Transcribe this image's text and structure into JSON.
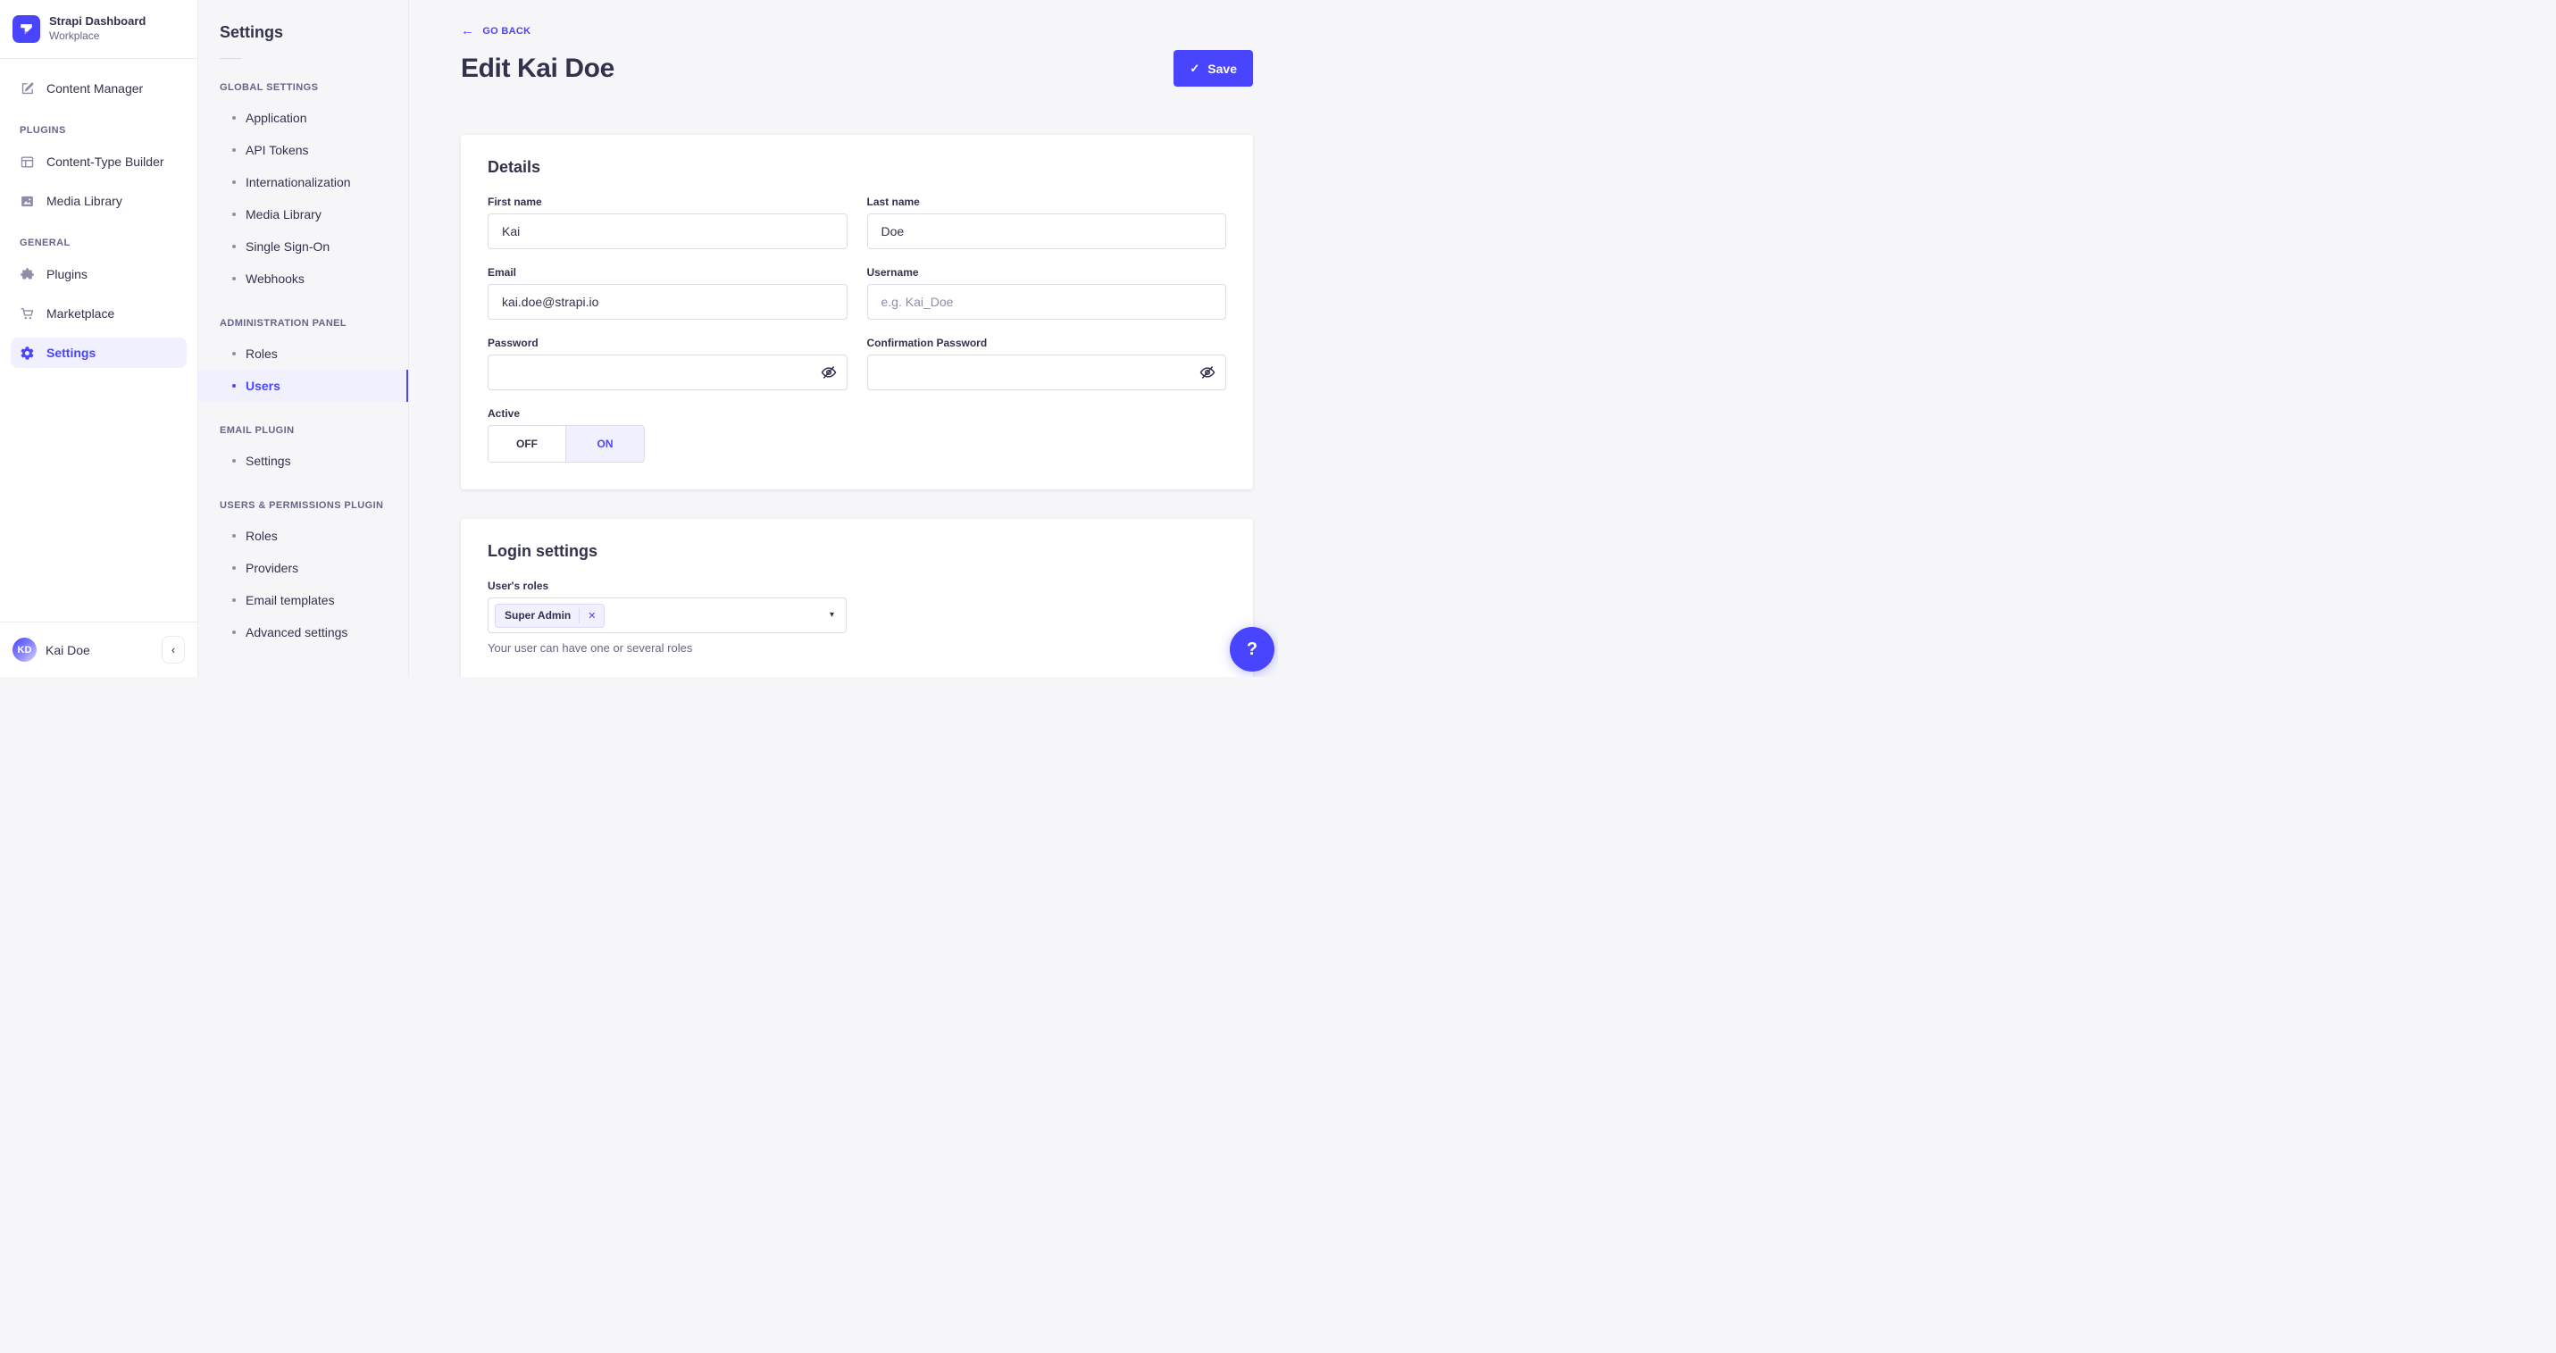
{
  "brand": {
    "title": "Strapi Dashboard",
    "subtitle": "Workplace"
  },
  "sidebar": {
    "content_manager": "Content Manager",
    "sections": [
      {
        "header": "PLUGINS",
        "items": [
          "Content-Type Builder",
          "Media Library"
        ]
      },
      {
        "header": "GENERAL",
        "items": [
          "Plugins",
          "Marketplace",
          "Settings"
        ]
      }
    ],
    "active_item": "Settings",
    "user": {
      "initials": "KD",
      "name": "Kai Doe"
    },
    "collapse_glyph": "‹"
  },
  "subnav": {
    "title": "Settings",
    "sections": [
      {
        "header": "GLOBAL SETTINGS",
        "items": [
          "Application",
          "API Tokens",
          "Internationalization",
          "Media Library",
          "Single Sign-On",
          "Webhooks"
        ]
      },
      {
        "header": "ADMINISTRATION PANEL",
        "items": [
          "Roles",
          "Users"
        ]
      },
      {
        "header": "EMAIL PLUGIN",
        "items": [
          "Settings"
        ]
      },
      {
        "header": "USERS & PERMISSIONS PLUGIN",
        "items": [
          "Roles",
          "Providers",
          "Email templates",
          "Advanced settings"
        ]
      }
    ],
    "active_item": "Users"
  },
  "header": {
    "back_glyph": "←",
    "back_label": "GO BACK",
    "title": "Edit Kai Doe",
    "save_check_glyph": "✓",
    "save_label": "Save"
  },
  "details_card": {
    "title": "Details",
    "first_name": {
      "label": "First name",
      "value": "Kai"
    },
    "last_name": {
      "label": "Last name",
      "value": "Doe"
    },
    "email": {
      "label": "Email",
      "value": "kai.doe@strapi.io"
    },
    "username": {
      "label": "Username",
      "placeholder": "e.g. Kai_Doe"
    },
    "password": {
      "label": "Password"
    },
    "confirmation_password": {
      "label": "Confirmation Password"
    },
    "active": {
      "label": "Active",
      "off_label": "OFF",
      "on_label": "ON",
      "value": "ON"
    }
  },
  "login_card": {
    "title": "Login settings",
    "roles_label": "User's roles",
    "selected_role": "Super Admin",
    "chip_close_glyph": "✕",
    "caret_glyph": "▾",
    "hint": "Your user can have one or several roles"
  },
  "help_button": {
    "glyph": "?"
  },
  "colors": {
    "primary": "#4945ff",
    "primary_light_bg": "#f0f0ff",
    "text": "#32324d",
    "text_secondary": "#666687",
    "placeholder": "#8e8ea9",
    "input_border": "#dcdce4",
    "panel_border": "#eaeaef",
    "page_bg": "#f6f6f9",
    "card_bg": "#ffffff"
  }
}
